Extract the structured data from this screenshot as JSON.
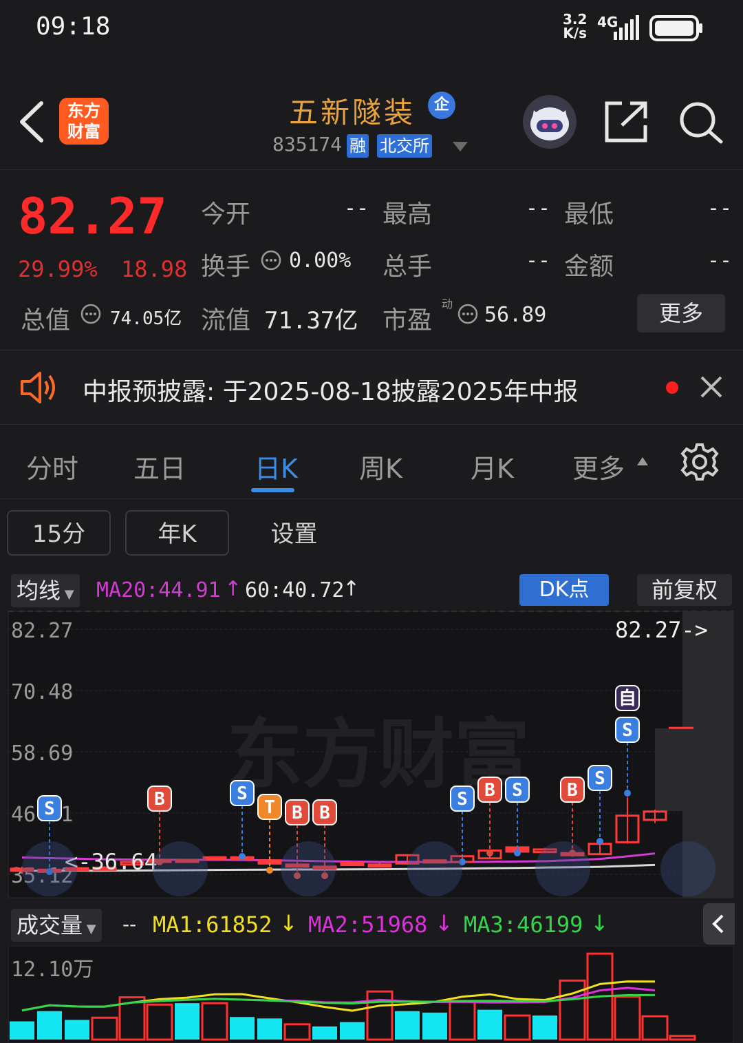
{
  "status": {
    "time": "09:18",
    "net_speed": "3.2\nK/s",
    "net_speed_top": "3.2",
    "net_speed_bottom": "K/s",
    "network": "4G"
  },
  "header": {
    "logo_line1": "东方",
    "logo_line2": "财富",
    "stock_name": "五新隧装",
    "badge": "企",
    "code": "835174",
    "tag_margin": "融",
    "tag_exchange": "北交所"
  },
  "quote": {
    "price": "82.27",
    "change_pct": "29.99%",
    "change_amt": "18.98",
    "open_label": "今开",
    "open_value": "--",
    "high_label": "最高",
    "high_value": "--",
    "low_label": "最低",
    "low_value": "--",
    "turnover_label": "换手",
    "turnover_value": "0.00%",
    "volume_label": "总手",
    "volume_value": "--",
    "amount_label": "金额",
    "amount_value": "--",
    "mktcap_label": "总值",
    "mktcap_value": "74.05亿",
    "float_label": "流值",
    "float_value": "71.37亿",
    "pe_label": "市盈",
    "pe_sup": "动",
    "pe_value": "56.89",
    "more_label": "更多"
  },
  "notice": {
    "text": "中报预披露: 于2025-08-18披露2025年中报"
  },
  "tabs": [
    "分时",
    "五日",
    "日K",
    "周K",
    "月K",
    "更多"
  ],
  "active_tab": "日K",
  "sub_buttons": {
    "min15": "15分",
    "yearK": "年K",
    "settings": "设置"
  },
  "ma_bar": {
    "selector": "均线",
    "ma20": "MA20:44.91",
    "ma60": "60:40.72",
    "dk": "DK点",
    "adjust": "前复权"
  },
  "chart_data": {
    "type": "candlestick",
    "y_ticks": [
      "82.27",
      "70.48",
      "58.69",
      "46.91",
      "35.12"
    ],
    "latest_label": "82.27->",
    "low_marker": "<-36.64",
    "colors": {
      "up": "#ff3b3b",
      "down": "#ff3b3b",
      "ma_magenta": "#d23cd2",
      "ma_white": "#d8d8d8"
    },
    "signals": [
      {
        "label": "S",
        "type": "sell"
      },
      {
        "label": "B",
        "type": "buy"
      },
      {
        "label": "S",
        "type": "sell"
      },
      {
        "label": "T",
        "type": "t"
      },
      {
        "label": "B",
        "type": "buy"
      },
      {
        "label": "B",
        "type": "buy"
      },
      {
        "label": "S",
        "type": "sell"
      },
      {
        "label": "B",
        "type": "buy"
      },
      {
        "label": "S",
        "type": "sell"
      },
      {
        "label": "B",
        "type": "buy"
      },
      {
        "label": "S",
        "type": "sell"
      },
      {
        "label": "S",
        "type": "sell"
      },
      {
        "label": "自",
        "type": "self"
      }
    ],
    "candles": [
      {
        "o": 36.2,
        "c": 35.8,
        "h": 36.6,
        "l": 35.2
      },
      {
        "o": 35.8,
        "c": 36.0,
        "h": 36.3,
        "l": 35.4
      },
      {
        "o": 36.0,
        "c": 36.3,
        "h": 36.8,
        "l": 35.8
      },
      {
        "o": 36.4,
        "c": 36.2,
        "h": 36.7,
        "l": 36.0
      },
      {
        "o": 37.0,
        "c": 37.5,
        "h": 37.9,
        "l": 36.8
      },
      {
        "o": 37.8,
        "c": 37.9,
        "h": 38.1,
        "l": 37.6
      },
      {
        "o": 37.9,
        "c": 37.8,
        "h": 38.0,
        "l": 37.5
      },
      {
        "o": 38.2,
        "c": 38.4,
        "h": 38.6,
        "l": 38.0
      },
      {
        "o": 38.3,
        "c": 38.4,
        "h": 38.6,
        "l": 38.0
      },
      {
        "o": 37.8,
        "c": 37.2,
        "h": 38.0,
        "l": 37.0
      },
      {
        "o": 37.0,
        "c": 36.8,
        "h": 37.2,
        "l": 36.5
      },
      {
        "o": 36.6,
        "c": 36.4,
        "h": 36.9,
        "l": 36.2
      },
      {
        "o": 37.0,
        "c": 37.3,
        "h": 37.5,
        "l": 36.8
      },
      {
        "o": 36.8,
        "c": 37.0,
        "h": 37.3,
        "l": 36.6
      },
      {
        "o": 37.2,
        "c": 38.8,
        "h": 39.0,
        "l": 37.0
      },
      {
        "o": 37.8,
        "c": 37.7,
        "h": 38.0,
        "l": 37.5
      },
      {
        "o": 37.5,
        "c": 38.6,
        "h": 38.8,
        "l": 37.4
      },
      {
        "o": 38.2,
        "c": 39.7,
        "h": 39.9,
        "l": 38.0
      },
      {
        "o": 40.3,
        "c": 39.5,
        "h": 40.5,
        "l": 39.0
      },
      {
        "o": 39.4,
        "c": 39.9,
        "h": 40.2,
        "l": 39.2
      },
      {
        "o": 38.8,
        "c": 39.2,
        "h": 39.5,
        "l": 38.5
      },
      {
        "o": 39.0,
        "c": 41.0,
        "h": 41.3,
        "l": 38.8
      },
      {
        "o": 41.3,
        "c": 46.4,
        "h": 50.0,
        "l": 41.0
      },
      {
        "o": 45.6,
        "c": 47.2,
        "h": 47.6,
        "l": 45.0
      },
      {
        "o": 63.3,
        "c": 63.3,
        "h": 63.3,
        "l": 63.3
      }
    ],
    "volume": {
      "label_selector": "成交量",
      "ma1": "MA1:61852",
      "ma2": "MA2:51968",
      "ma3": "MA3:46199",
      "max_label": "12.10万",
      "values": [
        2.5,
        3.9,
        2.7,
        3.0,
        5.8,
        4.8,
        5.0,
        5.0,
        3.1,
        2.9,
        2.1,
        1.8,
        2.4,
        6.6,
        3.9,
        3.7,
        5.3,
        4.1,
        3.3,
        3.3,
        8.1,
        11.8,
        5.9,
        3.2,
        0.5
      ],
      "colors": [
        "c",
        "c",
        "c",
        "r",
        "r",
        "r",
        "c",
        "r",
        "c",
        "c",
        "r",
        "c",
        "c",
        "r",
        "c",
        "c",
        "r",
        "c",
        "r",
        "c",
        "r",
        "r",
        "r",
        "r",
        "r"
      ]
    }
  }
}
